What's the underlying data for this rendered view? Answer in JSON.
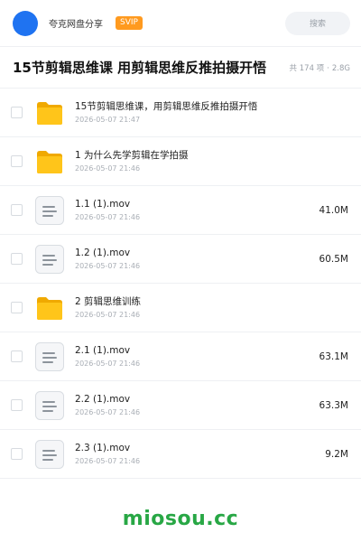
{
  "header": {
    "brand": "夸克网盘分享",
    "badge": "SVIP",
    "search_placeholder": "搜索"
  },
  "share": {
    "title": "15节剪辑思维课 用剪辑思维反推拍摄开悟",
    "count": "共 174 项",
    "separator": "·",
    "total_size": "2.8G"
  },
  "files": [
    {
      "type": "folder",
      "name": "15节剪辑思维课，用剪辑思维反推拍摄开悟",
      "date": "2026-05-07 21:47",
      "size": ""
    },
    {
      "type": "folder",
      "name": "1 为什么先学剪辑在学拍摄",
      "date": "2026-05-07 21:46",
      "size": ""
    },
    {
      "type": "file",
      "name": "1.1 (1).mov",
      "date": "2026-05-07 21:46",
      "size": "41.0M"
    },
    {
      "type": "file",
      "name": "1.2 (1).mov",
      "date": "2026-05-07 21:46",
      "size": "60.5M"
    },
    {
      "type": "folder",
      "name": "2 剪辑思维训练",
      "date": "2026-05-07 21:46",
      "size": ""
    },
    {
      "type": "file",
      "name": "2.1 (1).mov",
      "date": "2026-05-07 21:46",
      "size": "63.1M"
    },
    {
      "type": "file",
      "name": "2.2 (1).mov",
      "date": "2026-05-07 21:46",
      "size": "63.3M"
    },
    {
      "type": "file",
      "name": "2.3 (1).mov",
      "date": "2026-05-07 21:46",
      "size": "9.2M"
    }
  ],
  "footer": {
    "watermark": "miosou.cc"
  },
  "colors": {
    "brand_blue": "#1f73f1",
    "svip_orange": "#ff9a1f",
    "folder_yellow": "#ffc51a",
    "watermark_green": "#28a745"
  }
}
